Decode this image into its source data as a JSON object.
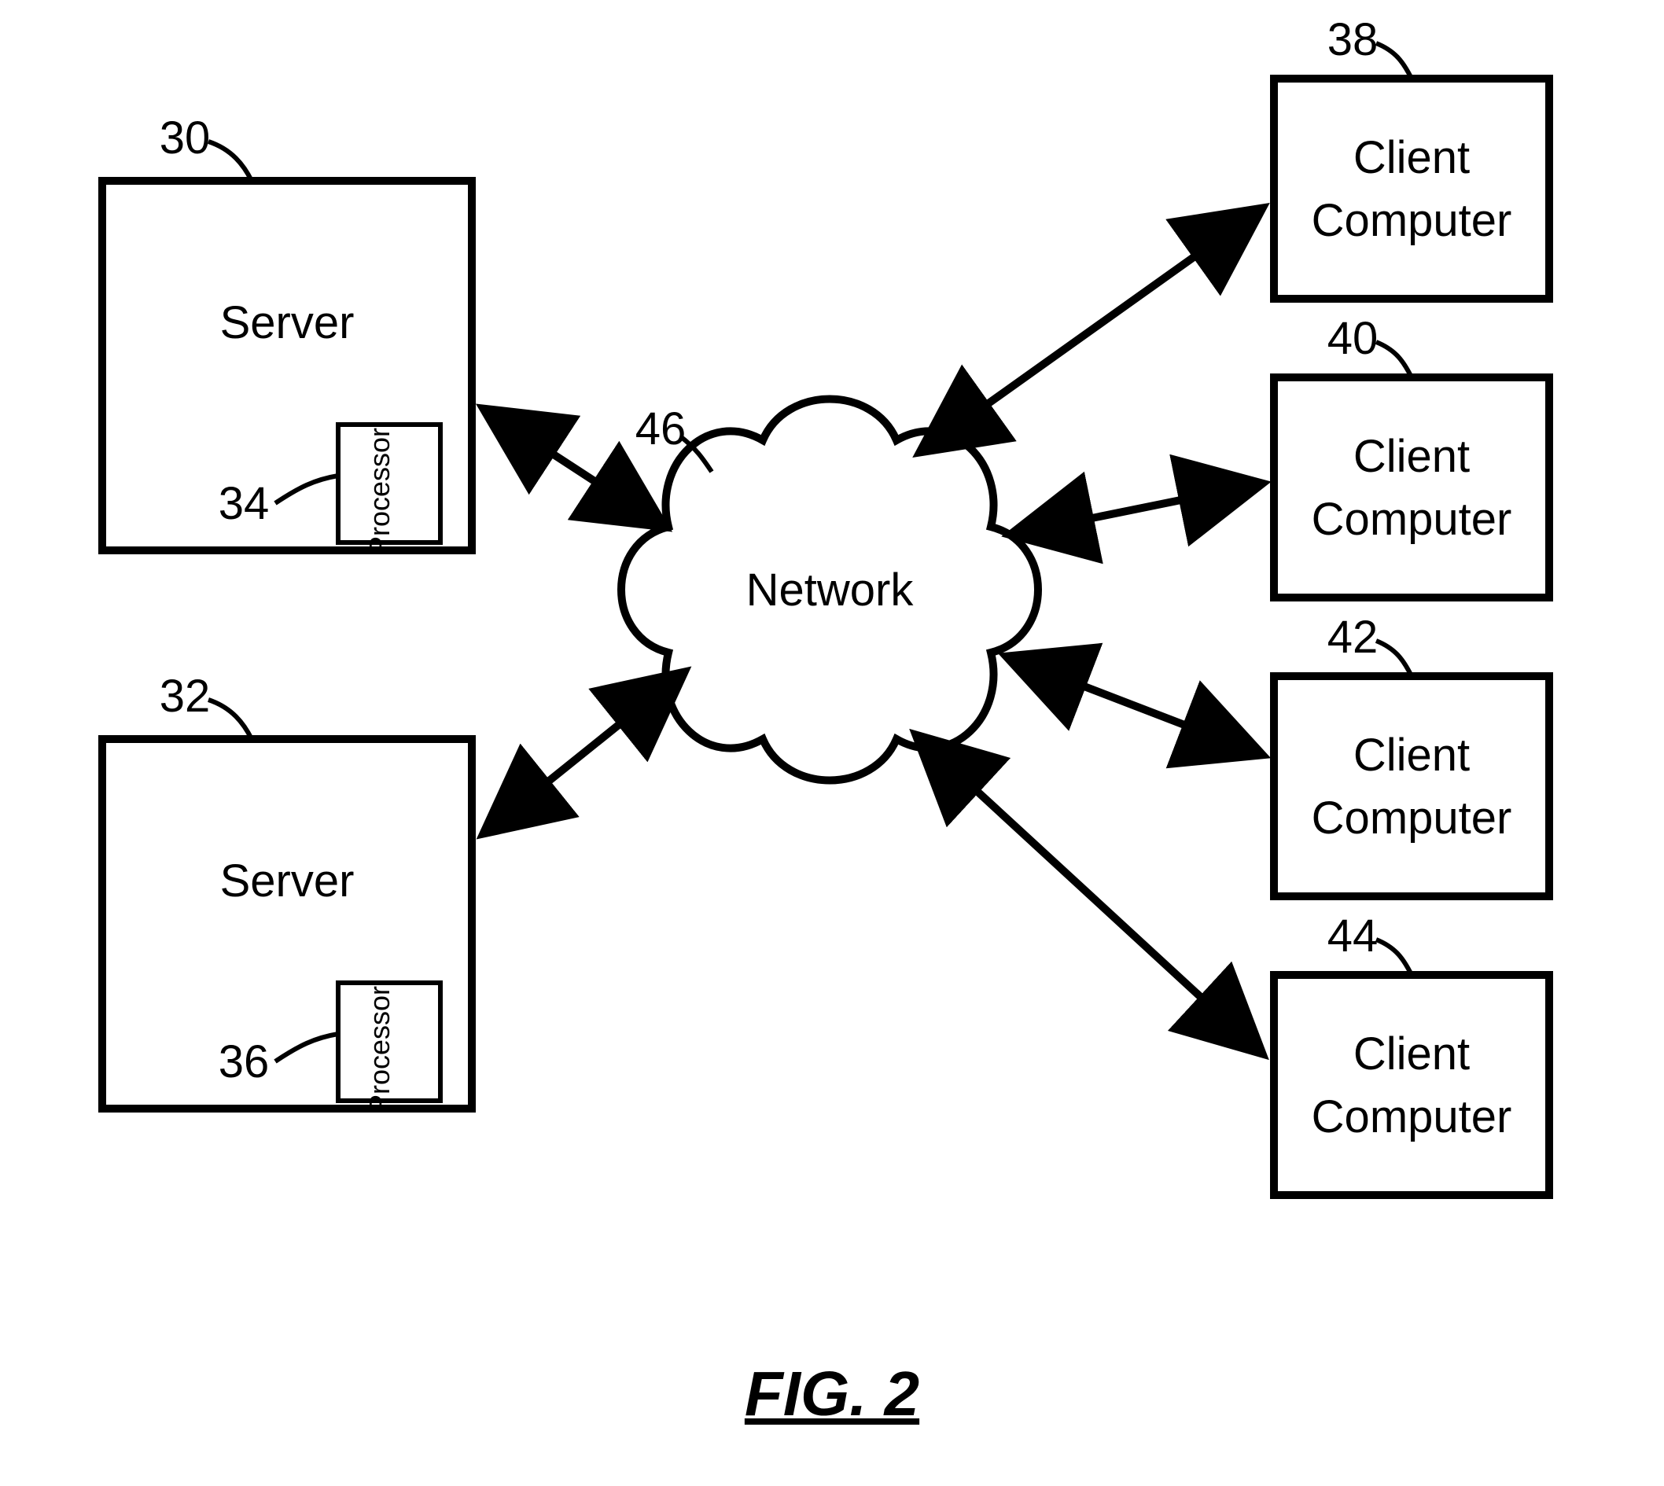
{
  "figure_caption": "FIG. 2",
  "servers": [
    {
      "ref": "30",
      "label": "Server",
      "proc_ref": "34",
      "proc_label": "Processor"
    },
    {
      "ref": "32",
      "label": "Server",
      "proc_ref": "36",
      "proc_label": "Processor"
    }
  ],
  "network": {
    "ref": "46",
    "label": "Network"
  },
  "clients": [
    {
      "ref": "38",
      "label_l1": "Client",
      "label_l2": "Computer"
    },
    {
      "ref": "40",
      "label_l1": "Client",
      "label_l2": "Computer"
    },
    {
      "ref": "42",
      "label_l1": "Client",
      "label_l2": "Computer"
    },
    {
      "ref": "44",
      "label_l1": "Client",
      "label_l2": "Computer"
    }
  ]
}
